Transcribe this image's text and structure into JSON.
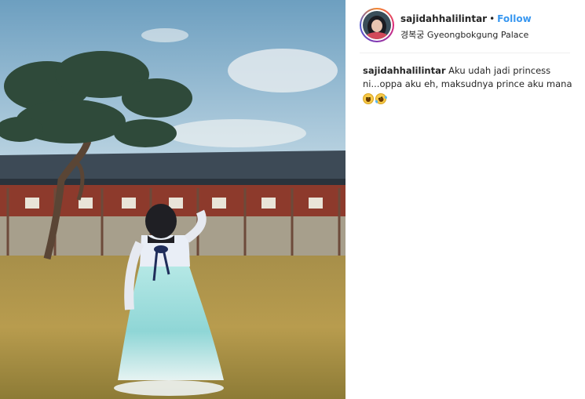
{
  "post": {
    "username": "sajidahhalilintar",
    "separator": "•",
    "follow_label": "Follow",
    "location": "경복궁 Gyeongbokgung Palace",
    "caption_text": "Aku udah jadi princess ni...oppa aku eh, maksudnya prince aku mana",
    "emojis": [
      "grinning-sweat-emoji",
      "rolling-laughing-emoji"
    ]
  },
  "photo": {
    "description_icon": "photo-image"
  },
  "colors": {
    "follow_blue": "#3897f0",
    "text_dark": "#262626",
    "divider": "#efefef"
  }
}
